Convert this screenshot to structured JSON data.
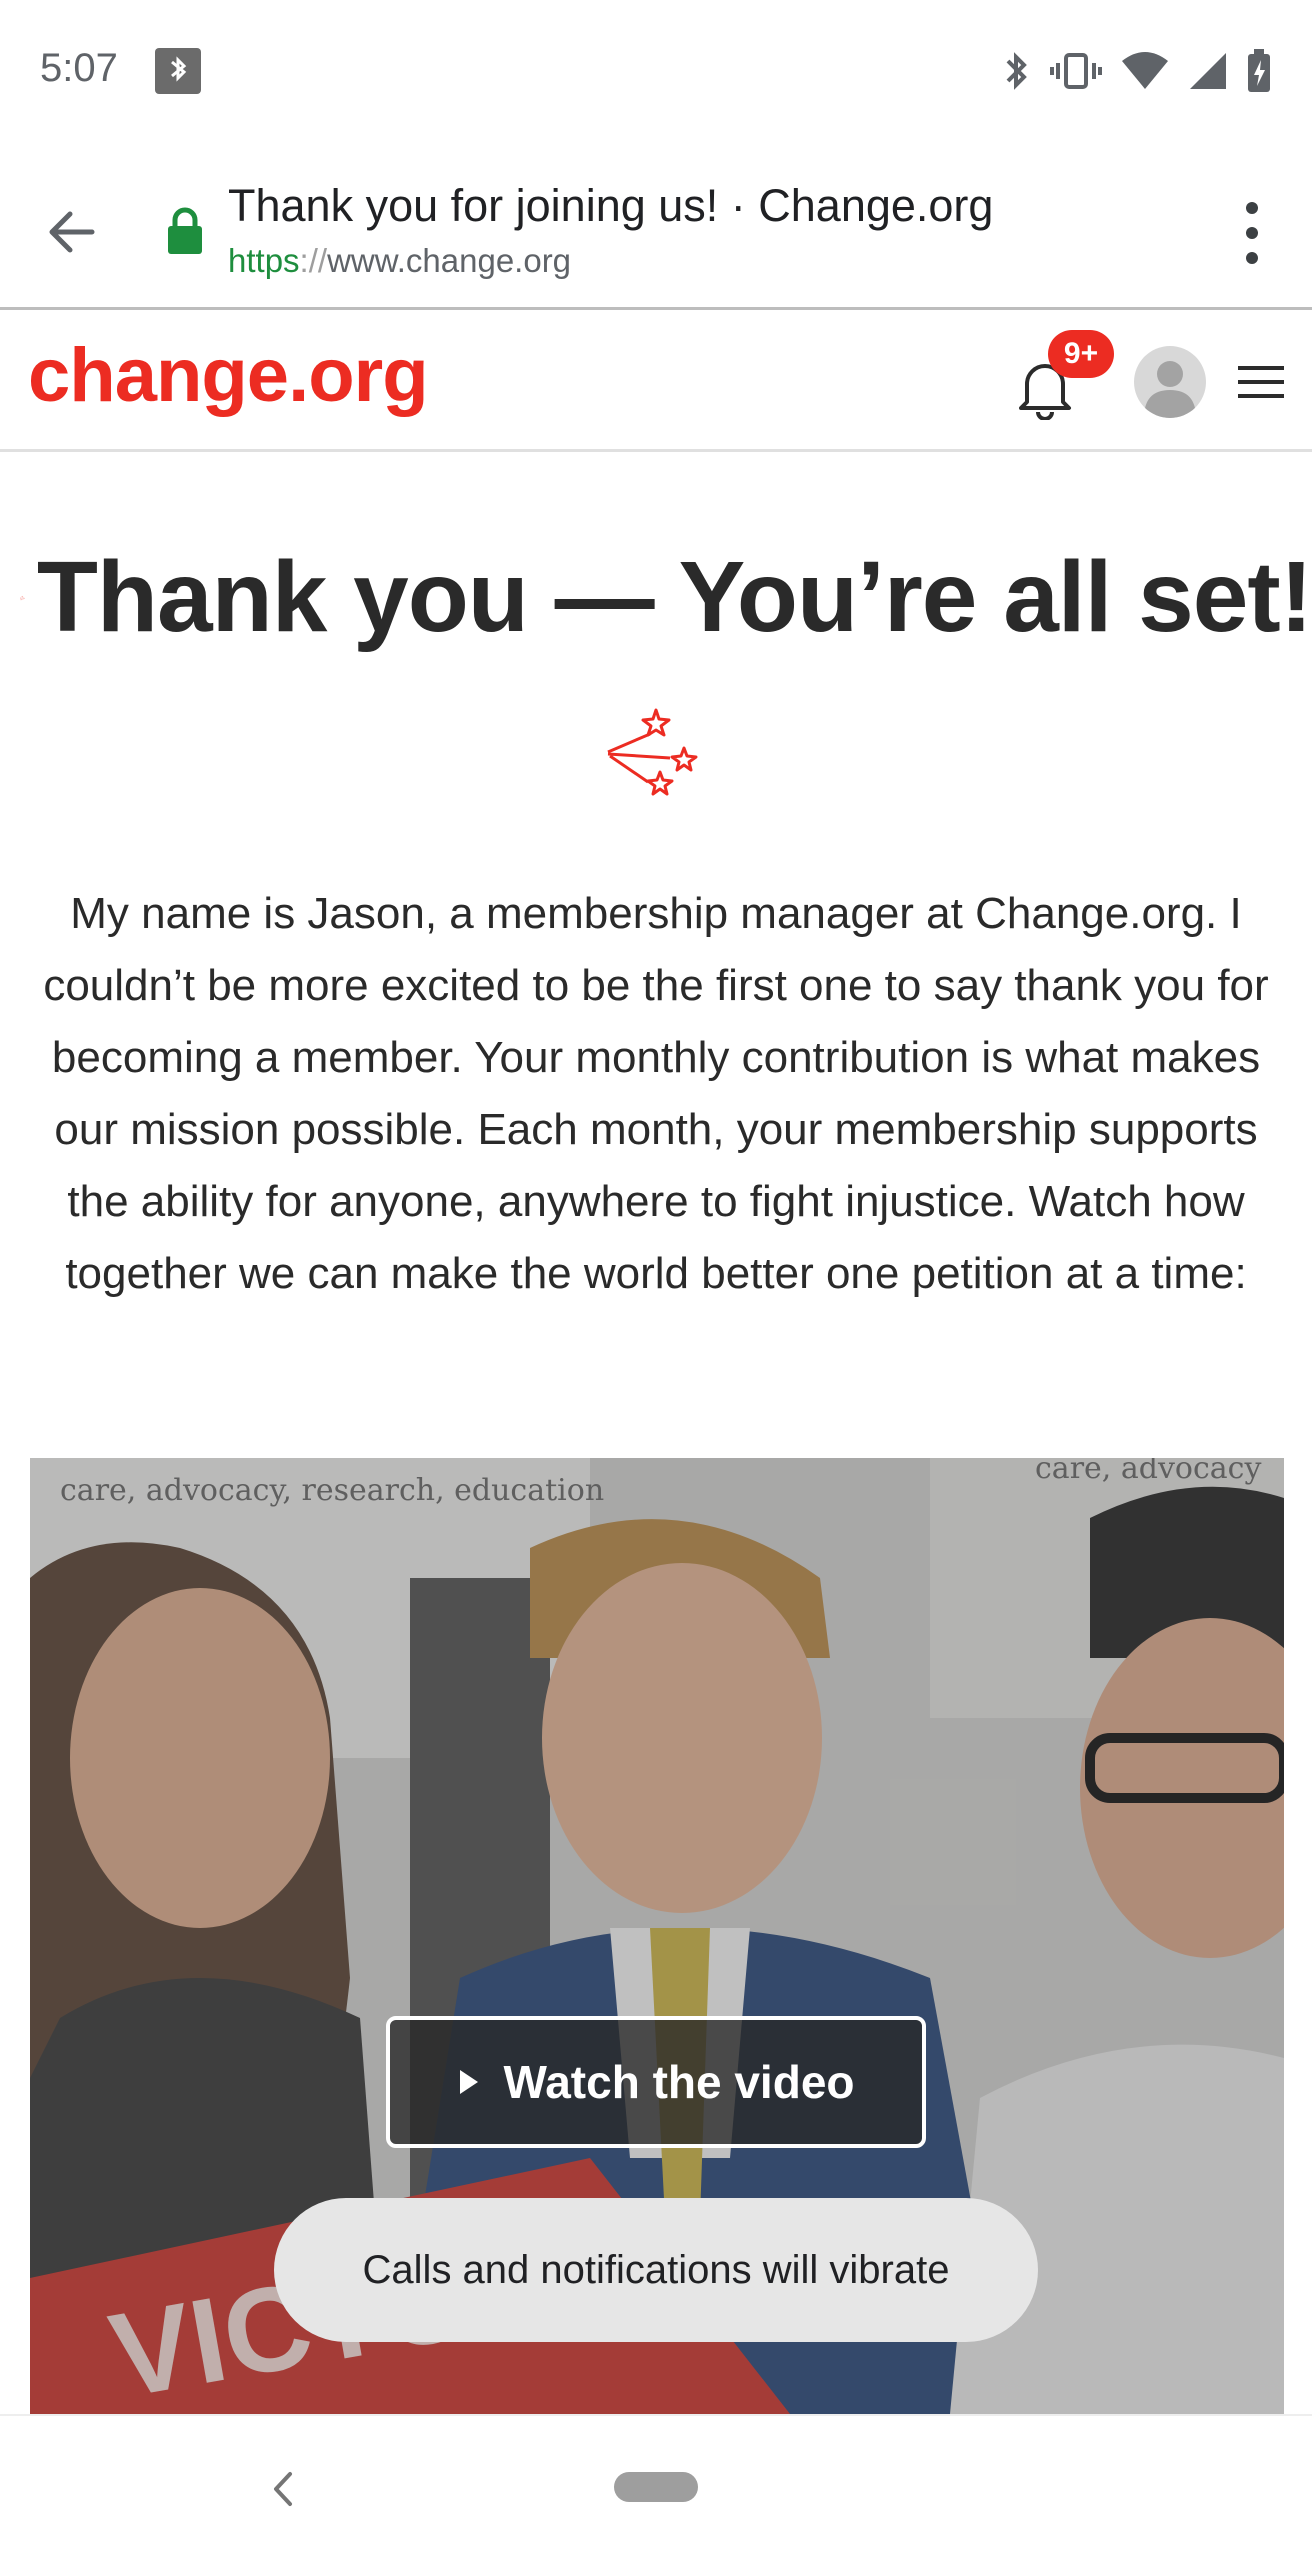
{
  "status_bar": {
    "time": "5:07",
    "icons": [
      "bluetooth-app-icon",
      "bluetooth-icon",
      "vibrate-icon",
      "wifi-icon",
      "signal-icon",
      "battery-charging-icon"
    ]
  },
  "browser": {
    "page_title": "Thank you for joining us! · Change.org",
    "url_scheme": "https",
    "url_sep": "://",
    "url_host": "www.change.org"
  },
  "site_header": {
    "logo": "change.org",
    "notification_count": "9+"
  },
  "content": {
    "headline": "Thank you — You’re all set!",
    "intro": "My name is Jason, a membership manager at Change.org. I couldn’t be more excited to be the first one to say thank you for becoming a member. Your monthly contribution is what makes our mission possible. Each month, your membership supports the ability for anyone, anywhere to fight injustice. Watch how together we can make the world better one petition at a time:",
    "watch_video_label": "Watch the video",
    "video_backdrop_text_left": "care, advocacy, research, education",
    "video_backdrop_text_right": "care, advocacy",
    "video_sign_text": "VICTORY!"
  },
  "toast": {
    "message": "Calls and notifications will vibrate"
  },
  "colors": {
    "brand_red": "#ec2c22",
    "secure_green": "#1e8e3e"
  }
}
